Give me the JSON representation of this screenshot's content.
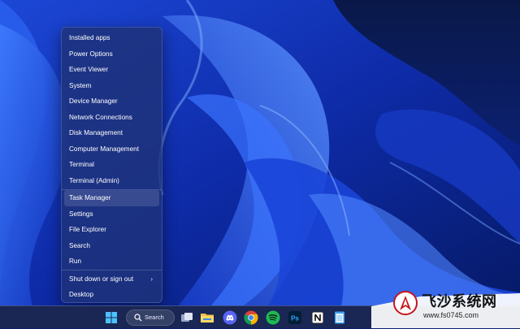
{
  "menu": {
    "items": [
      {
        "label": "Installed apps"
      },
      {
        "label": "Power Options"
      },
      {
        "label": "Event Viewer"
      },
      {
        "label": "System"
      },
      {
        "label": "Device Manager"
      },
      {
        "label": "Network Connections"
      },
      {
        "label": "Disk Management"
      },
      {
        "label": "Computer Management"
      },
      {
        "label": "Terminal"
      },
      {
        "label": "Terminal (Admin)"
      },
      {
        "label": "Task Manager"
      },
      {
        "label": "Settings"
      },
      {
        "label": "File Explorer"
      },
      {
        "label": "Search"
      },
      {
        "label": "Run"
      },
      {
        "label": "Shut down or sign out",
        "chevron": "›"
      },
      {
        "label": "Desktop"
      }
    ],
    "highlighted_label": "Task Manager"
  },
  "taskbar": {
    "search_label": "Search",
    "icons": [
      "windows-start-icon",
      "search-icon",
      "task-view-icon",
      "file-explorer-icon",
      "discord-icon",
      "chrome-icon",
      "spotify-icon",
      "photoshop-icon",
      "notion-icon",
      "notepad-icon"
    ],
    "photoshop_label": "Ps"
  },
  "watermark": {
    "title": "飞沙系统网",
    "url": "www.fs0745.com"
  },
  "colors": {
    "taskbar": "#1a2653",
    "menu_bg": "#1e3278",
    "windows_blue": "#4cc2ff",
    "watermark_red": "#c5161d"
  }
}
